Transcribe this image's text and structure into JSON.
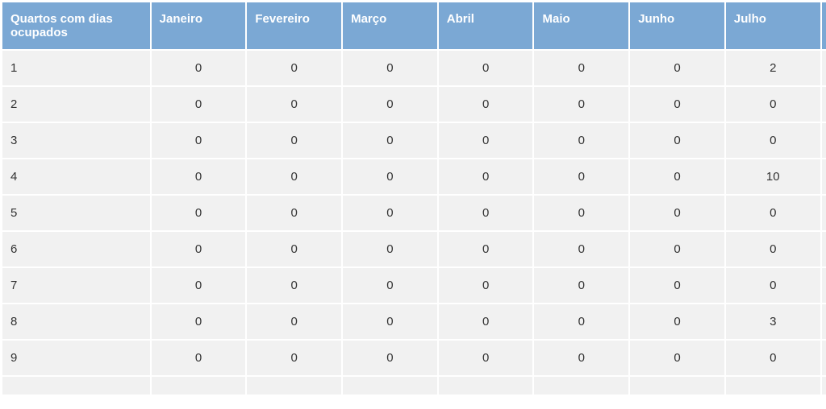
{
  "table": {
    "headerFirst": "Quartos com dias ocupados",
    "months": [
      "Janeiro",
      "Fevereiro",
      "Março",
      "Abril",
      "Maio",
      "Junho",
      "Julho"
    ],
    "partialMonth": "",
    "rows": [
      {
        "label": "1",
        "values": [
          "0",
          "0",
          "0",
          "0",
          "0",
          "0",
          "2"
        ]
      },
      {
        "label": "2",
        "values": [
          "0",
          "0",
          "0",
          "0",
          "0",
          "0",
          "0"
        ]
      },
      {
        "label": "3",
        "values": [
          "0",
          "0",
          "0",
          "0",
          "0",
          "0",
          "0"
        ]
      },
      {
        "label": "4",
        "values": [
          "0",
          "0",
          "0",
          "0",
          "0",
          "0",
          "10"
        ]
      },
      {
        "label": "5",
        "values": [
          "0",
          "0",
          "0",
          "0",
          "0",
          "0",
          "0"
        ]
      },
      {
        "label": "6",
        "values": [
          "0",
          "0",
          "0",
          "0",
          "0",
          "0",
          "0"
        ]
      },
      {
        "label": "7",
        "values": [
          "0",
          "0",
          "0",
          "0",
          "0",
          "0",
          "0"
        ]
      },
      {
        "label": "8",
        "values": [
          "0",
          "0",
          "0",
          "0",
          "0",
          "0",
          "3"
        ]
      },
      {
        "label": "9",
        "values": [
          "0",
          "0",
          "0",
          "0",
          "0",
          "0",
          "0"
        ]
      }
    ]
  },
  "chart_data": {
    "type": "table",
    "title": "Quartos com dias ocupados",
    "columns": [
      "Janeiro",
      "Fevereiro",
      "Março",
      "Abril",
      "Maio",
      "Junho",
      "Julho"
    ],
    "row_labels": [
      "1",
      "2",
      "3",
      "4",
      "5",
      "6",
      "7",
      "8",
      "9"
    ],
    "data": [
      [
        0,
        0,
        0,
        0,
        0,
        0,
        2
      ],
      [
        0,
        0,
        0,
        0,
        0,
        0,
        0
      ],
      [
        0,
        0,
        0,
        0,
        0,
        0,
        0
      ],
      [
        0,
        0,
        0,
        0,
        0,
        0,
        10
      ],
      [
        0,
        0,
        0,
        0,
        0,
        0,
        0
      ],
      [
        0,
        0,
        0,
        0,
        0,
        0,
        0
      ],
      [
        0,
        0,
        0,
        0,
        0,
        0,
        0
      ],
      [
        0,
        0,
        0,
        0,
        0,
        0,
        3
      ],
      [
        0,
        0,
        0,
        0,
        0,
        0,
        0
      ]
    ]
  }
}
